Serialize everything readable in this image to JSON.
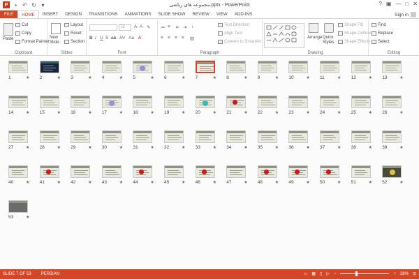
{
  "window": {
    "title": "مجموعه های ریاضی.pptx - PowerPoint",
    "app_logo": "P",
    "controls": [
      "?",
      "▣",
      "—",
      "□",
      "✕"
    ]
  },
  "quick_access": [
    "save-icon",
    "undo-icon",
    "redo-icon",
    "customize-icon"
  ],
  "tabs": [
    {
      "label": "FILE"
    },
    {
      "label": "HOME"
    },
    {
      "label": "INSERT"
    },
    {
      "label": "DESIGN"
    },
    {
      "label": "TRANSITIONS"
    },
    {
      "label": "ANIMATIONS"
    },
    {
      "label": "SLIDE SHOW"
    },
    {
      "label": "REVIEW"
    },
    {
      "label": "VIEW"
    },
    {
      "label": "ADD-INS"
    }
  ],
  "account": {
    "signin": "Sign in"
  },
  "ribbon": {
    "clipboard": {
      "label": "Clipboard",
      "paste": "Paste",
      "cut": "Cut",
      "copy": "Copy",
      "format_painter": "Format Painter"
    },
    "slides": {
      "label": "Slides",
      "new_slide": "New Slide",
      "layout": "Layout",
      "reset": "Reset",
      "section": "Section"
    },
    "font": {
      "label": "Font",
      "size": "72"
    },
    "paragraph": {
      "label": "Paragraph",
      "text_direction": "Text Direction",
      "align_text": "Align Text",
      "convert_smartart": "Convert to SmartArt"
    },
    "drawing": {
      "label": "Drawing",
      "arrange": "Arrange",
      "quick_styles": "Quick Styles",
      "shape_fill": "Shape Fill",
      "shape_outline": "Shape Outline",
      "shape_effects": "Shape Effects"
    },
    "editing": {
      "label": "Editing",
      "find": "Find",
      "replace": "Replace",
      "select": "Select"
    }
  },
  "slides": [
    {
      "n": "1"
    },
    {
      "n": "2"
    },
    {
      "n": "3"
    },
    {
      "n": "4"
    },
    {
      "n": "5"
    },
    {
      "n": "6"
    },
    {
      "n": "7"
    },
    {
      "n": "8"
    },
    {
      "n": "9"
    },
    {
      "n": "10"
    },
    {
      "n": "11"
    },
    {
      "n": "12"
    },
    {
      "n": "13"
    },
    {
      "n": "14"
    },
    {
      "n": "15"
    },
    {
      "n": "16"
    },
    {
      "n": "17"
    },
    {
      "n": "18"
    },
    {
      "n": "19"
    },
    {
      "n": "20"
    },
    {
      "n": "21"
    },
    {
      "n": "22"
    },
    {
      "n": "23"
    },
    {
      "n": "24"
    },
    {
      "n": "25"
    },
    {
      "n": "26"
    },
    {
      "n": "27"
    },
    {
      "n": "28"
    },
    {
      "n": "29"
    },
    {
      "n": "30"
    },
    {
      "n": "31"
    },
    {
      "n": "32"
    },
    {
      "n": "33"
    },
    {
      "n": "34"
    },
    {
      "n": "35"
    },
    {
      "n": "36"
    },
    {
      "n": "37"
    },
    {
      "n": "38"
    },
    {
      "n": "39"
    },
    {
      "n": "40"
    },
    {
      "n": "41"
    },
    {
      "n": "42"
    },
    {
      "n": "43"
    },
    {
      "n": "44"
    },
    {
      "n": "45"
    },
    {
      "n": "46"
    },
    {
      "n": "47"
    },
    {
      "n": "48"
    },
    {
      "n": "49"
    },
    {
      "n": "50"
    },
    {
      "n": "51"
    },
    {
      "n": "52"
    },
    {
      "n": "53"
    }
  ],
  "selected_slide": "7",
  "status": {
    "slide": "SLIDE 7 OF 53",
    "language": "PERSIAN",
    "zoom": "28%"
  },
  "colors": {
    "accent": "#d24726"
  }
}
